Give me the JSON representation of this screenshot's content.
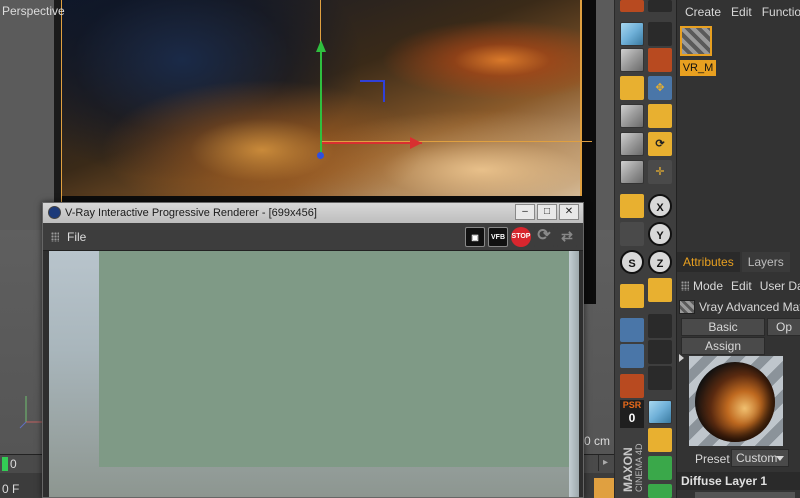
{
  "viewport": {
    "label": "Perspective",
    "frame_value": "0",
    "frame_unit": "0 F",
    "scale_label": "0 cm"
  },
  "vray_window": {
    "title": "V-Ray Interactive Progressive Renderer - [699x456]",
    "menu_file": "File",
    "btn_minimize": "‒",
    "btn_maximize": "□",
    "btn_close": "✕",
    "tool_vfb_a": "▣",
    "tool_vfb_b": "VFB",
    "tool_stop": "STOP",
    "tool_refresh": "⟳",
    "tool_swap": "⇄"
  },
  "material_manager": {
    "menu": [
      "Create",
      "Edit",
      "Function"
    ],
    "material_name": "VR_M"
  },
  "attributes": {
    "tabs": [
      "Attributes",
      "Layers"
    ],
    "menu": [
      "Mode",
      "Edit",
      "User Data"
    ],
    "object_name": "Vray Advanced Material",
    "btn_basic": "Basic",
    "btn_op": "Op",
    "btn_assign": "Assign",
    "preset_label": "Preset",
    "preset_value": "Custom",
    "section": "Diffuse Layer 1"
  },
  "toolbar": {
    "x_label": "X",
    "y_label": "Y",
    "z_label": "Z",
    "s_label": "S",
    "psr_top": "PSR",
    "psr_value": "0",
    "brand": "MAXON",
    "brand_sub": "CINEMA 4D"
  },
  "colors": {
    "accent": "#e8a020",
    "axis_x": "#d83030",
    "axis_y": "#2fbf3f",
    "axis_z": "#3040d8",
    "frame_indicator": "#33cc55",
    "stop": "#d8262e"
  }
}
